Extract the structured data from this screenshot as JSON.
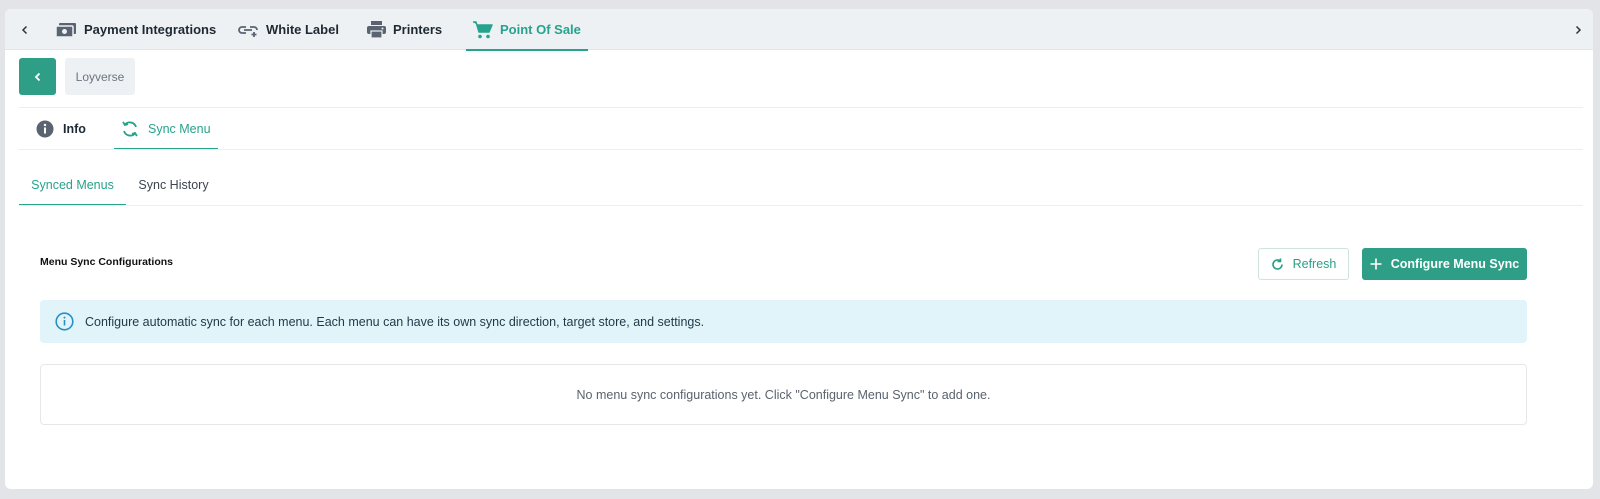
{
  "top_tabs": [
    {
      "label": "Payment Integrations",
      "icon": "money-icon",
      "active": false
    },
    {
      "label": "White Label",
      "icon": "link-icon",
      "active": false
    },
    {
      "label": "Printers",
      "icon": "printer-icon",
      "active": false
    },
    {
      "label": "Point Of Sale",
      "icon": "cart-icon",
      "active": true
    }
  ],
  "breadcrumb": {
    "label": "Loyverse"
  },
  "sub_tabs": [
    {
      "label": "Info",
      "icon": "info-icon",
      "active": false
    },
    {
      "label": "Sync Menu",
      "icon": "sync-icon",
      "active": true
    }
  ],
  "menu_tabs": [
    {
      "label": "Synced Menus",
      "active": true
    },
    {
      "label": "Sync History",
      "active": false
    }
  ],
  "section": {
    "title": "Menu Sync Configurations",
    "refresh_label": "Refresh",
    "configure_label": "Configure Menu Sync"
  },
  "info_banner": {
    "text": "Configure automatic sync for each menu. Each menu can have its own sync direction, target store, and settings."
  },
  "empty_state": {
    "text": "No menu sync configurations yet. Click \"Configure Menu Sync\" to add one."
  },
  "colors": {
    "accent": "#2e9f86",
    "accent_text": "#26a38c",
    "topbar_bg": "#edf1f4",
    "banner_bg": "#e1f4fa",
    "banner_icon": "#2a8fc4"
  }
}
